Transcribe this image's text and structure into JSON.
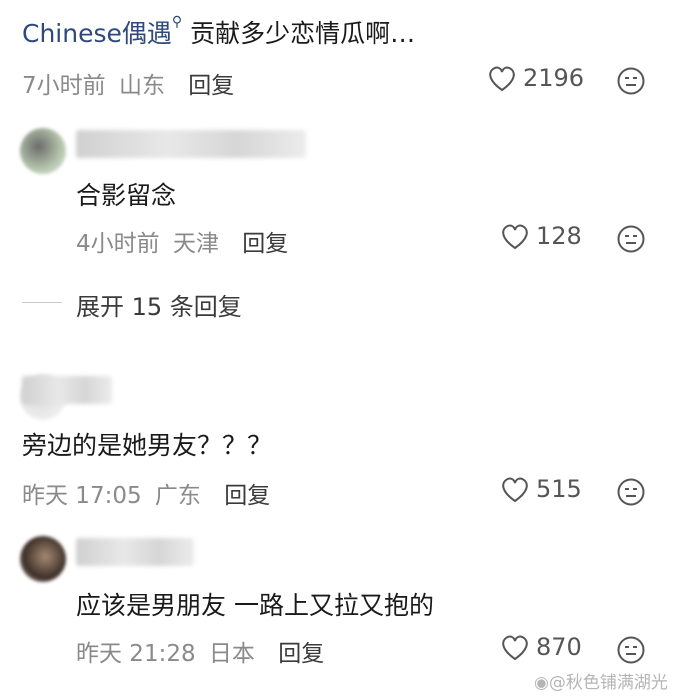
{
  "top_comment": {
    "mention": "Chinese偶遇",
    "text": "贡献多少恋情瓜啊…",
    "time": "7小时前",
    "location": "山东",
    "reply_label": "回复",
    "likes": "2196"
  },
  "comment2": {
    "text": "合影留念",
    "time": "4小时前",
    "location": "天津",
    "reply_label": "回复",
    "likes": "128",
    "expand_label": "展开 15 条回复"
  },
  "comment3": {
    "text": "旁边的是她男友？？？",
    "time": "昨天 17:05",
    "location": "广东",
    "reply_label": "回复",
    "likes": "515"
  },
  "comment4": {
    "text": "应该是男朋友 一路上又拉又抱的",
    "time": "昨天 21:28",
    "location": "日本",
    "reply_label": "回复",
    "likes": "870"
  },
  "watermark": "@秋色铺满湖光",
  "colors": {
    "meta": "#8a8a8a",
    "mention": "#2e4a7c"
  }
}
